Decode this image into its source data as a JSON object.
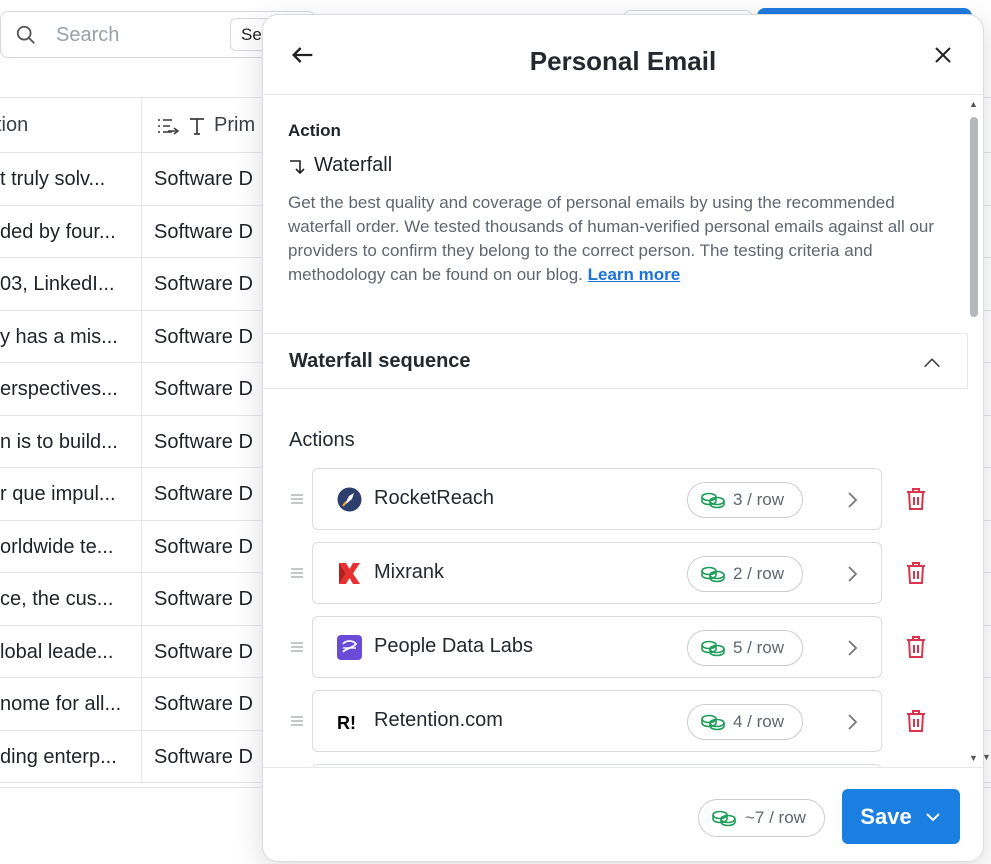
{
  "search": {
    "placeholder": "Search",
    "button_label": "Sea"
  },
  "table": {
    "headers": [
      "tion",
      "Prim"
    ],
    "rows": [
      [
        "t truly solv...",
        "Software D"
      ],
      [
        "ded by four...",
        "Software D"
      ],
      [
        "03, LinkedI...",
        "Software D"
      ],
      [
        "y has a mis...",
        "Software D"
      ],
      [
        "erspectives...",
        "Software D"
      ],
      [
        "n is to build...",
        "Software D"
      ],
      [
        "r que impul...",
        "Software D"
      ],
      [
        "orldwide te...",
        "Software D"
      ],
      [
        "ce, the cus...",
        "Software D"
      ],
      [
        "lobal leade...",
        "Software D"
      ],
      [
        "nome for all...",
        "Software D"
      ],
      [
        "ding enterp...",
        "Software D"
      ]
    ]
  },
  "panel": {
    "title": "Personal Email",
    "action_label": "Action",
    "action_name": "Waterfall",
    "description": "Get the best quality and coverage of personal emails by using the recommended waterfall order. We tested thousands of human-verified personal emails against all our providers to confirm they belong to the correct person. The testing criteria and methodology can be found on our blog.",
    "learn_more": "Learn more",
    "sequence_title": "Waterfall sequence",
    "actions_label": "Actions",
    "providers": [
      {
        "name": "RocketReach",
        "cost": "3 / row",
        "logo": "rocketreach-logo"
      },
      {
        "name": "Mixrank",
        "cost": "2 / row",
        "logo": "mixrank-logo"
      },
      {
        "name": "People Data Labs",
        "cost": "5 / row",
        "logo": "people-data-labs-logo"
      },
      {
        "name": "Retention.com",
        "cost": "4 / row",
        "logo": "retention-logo"
      }
    ],
    "total_cost": "~7 / row",
    "save_label": "Save"
  },
  "colors": {
    "accent": "#1a7fe0",
    "coin": "#1e9e5a",
    "trash": "#d9364d",
    "link": "#1a73d9"
  }
}
